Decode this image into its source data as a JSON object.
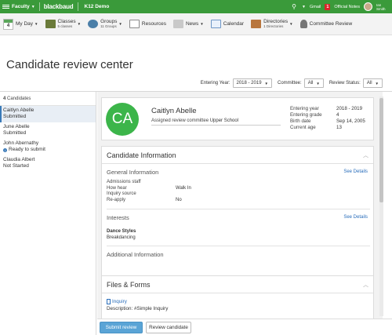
{
  "topbar": {
    "faculty": "Faculty",
    "brand": "blackbaud",
    "school": "K12 Demo",
    "gmail": "Gmail",
    "notes_count": "1",
    "notes_label": "Official Notes",
    "user_first": "Ian",
    "user_last": "Smith"
  },
  "nav": {
    "myday_num": "4",
    "myday": "My Day",
    "classes": "Classes",
    "classes_sub": "5 classes",
    "groups": "Groups",
    "groups_sub": "11 Groups",
    "resources": "Resources",
    "news": "News",
    "calendar": "Calendar",
    "directories": "Directories",
    "directories_sub": "1 Directories",
    "committee_review": "Committee Review"
  },
  "page": {
    "title": "Candidate review center"
  },
  "filters": {
    "entering_year_label": "Entering Year:",
    "entering_year_value": "2018 - 2019",
    "committee_label": "Committee:",
    "committee_value": "All",
    "review_status_label": "Review Status:",
    "review_status_value": "All"
  },
  "candidates": {
    "count": "4",
    "label": "Candidates",
    "items": [
      {
        "name": "Caitlyn Abelle",
        "status": "Submitted"
      },
      {
        "name": "June Abelle",
        "status": "Submitted"
      },
      {
        "name": "John Abernathy",
        "status": "Ready to submit"
      },
      {
        "name": "Claudia Albert",
        "status": "Not Started"
      }
    ]
  },
  "profile": {
    "initials": "CA",
    "name": "Caitlyn Abelle",
    "assigned_label": "Assigned review committee",
    "assigned_value": "Upper School",
    "entering_year_label": "Entering year",
    "entering_year_value": "2018 - 2019",
    "entering_grade_label": "Entering grade",
    "entering_grade_value": "4",
    "birth_date_label": "Birth date",
    "birth_date_value": "Sep 14, 2005",
    "current_age_label": "Current age",
    "current_age_value": "13"
  },
  "candidate_info": {
    "title": "Candidate Information",
    "general_title": "General Information",
    "see_details": "See Details",
    "fields": [
      {
        "k": "Admissions staff",
        "v": ""
      },
      {
        "k": "How hear",
        "v": "Walk In"
      },
      {
        "k": "Inquiry source",
        "v": ""
      },
      {
        "k": "Re-apply",
        "v": "No"
      }
    ],
    "interests_title": "Interests",
    "interest_name": "Dance Styles",
    "interest_value": "Breakdancing",
    "additional_title": "Additional Information"
  },
  "files": {
    "title": "Files & Forms",
    "link": "Inquiry",
    "desc_label": "Description:",
    "desc_value": "#Simple Inquiry"
  },
  "actions": {
    "submit": "Submit review",
    "review": "Review candidate"
  },
  "colors": {
    "topbar": "#3a9a3a",
    "avatar_green": "#3cb54a",
    "link_blue": "#2a6ebb",
    "primary_button": "#5aa4d6"
  }
}
